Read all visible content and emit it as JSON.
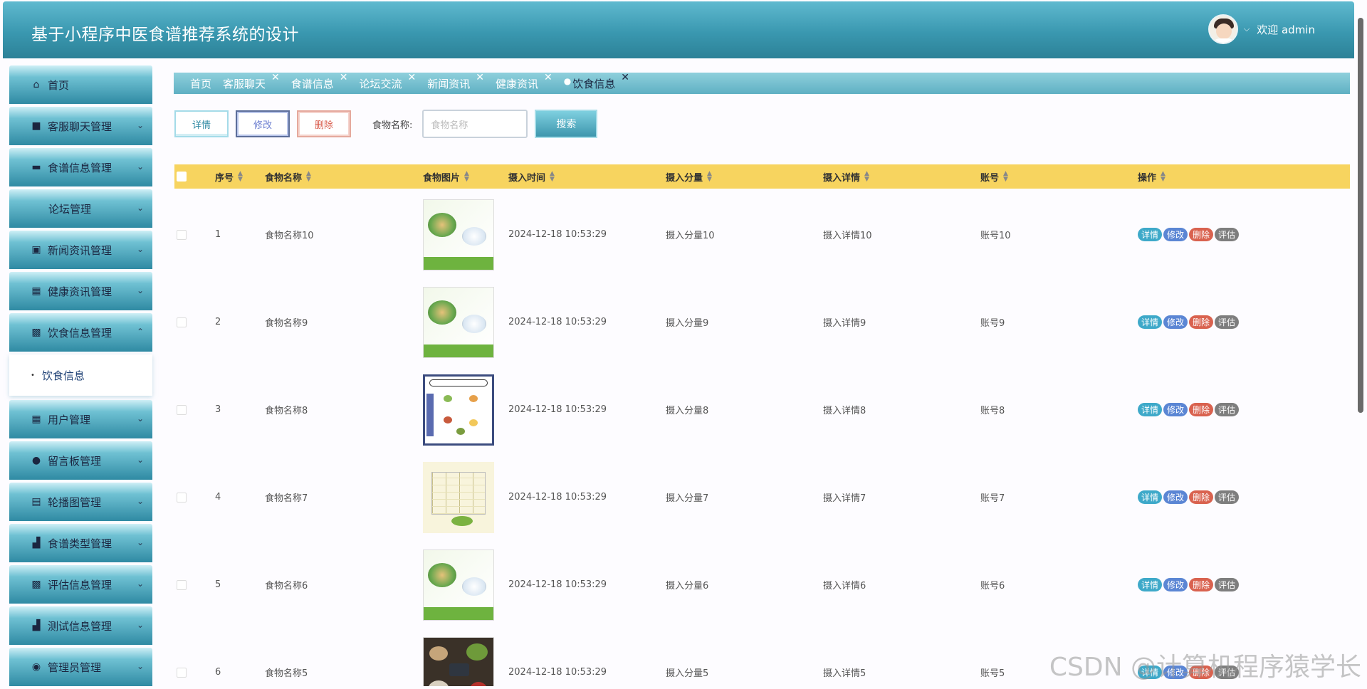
{
  "header": {
    "title": "基于小程序中医食谱推荐系统的设计",
    "welcome": "欢迎 admin"
  },
  "sidebar": {
    "items": [
      {
        "label": "首页",
        "icon": "home-icon"
      },
      {
        "label": "客服聊天管理",
        "icon": "mouse-icon"
      },
      {
        "label": "食谱信息管理",
        "icon": "card-icon"
      },
      {
        "label": "论坛管理",
        "icon": ""
      },
      {
        "label": "新闻资讯管理",
        "icon": "chip-icon"
      },
      {
        "label": "健康资讯管理",
        "icon": "grid-icon"
      },
      {
        "label": "饮食信息管理",
        "icon": "layout-icon"
      },
      {
        "label": "用户管理",
        "icon": "grid-icon"
      },
      {
        "label": "留言板管理",
        "icon": "drop-icon"
      },
      {
        "label": "轮播图管理",
        "icon": "list-icon"
      },
      {
        "label": "食谱类型管理",
        "icon": "chart-icon"
      },
      {
        "label": "评估信息管理",
        "icon": "layout-icon"
      },
      {
        "label": "测试信息管理",
        "icon": "chart-icon"
      },
      {
        "label": "管理员管理",
        "icon": "user-icon"
      }
    ],
    "submenu": "饮食信息"
  },
  "tabs": [
    "首页",
    "客服聊天",
    "食谱信息",
    "论坛交流",
    "新闻资讯",
    "健康资讯",
    "饮食信息"
  ],
  "toolbar": {
    "detail": "详情",
    "edit": "修改",
    "delete": "删除",
    "search_label": "食物名称:",
    "search_placeholder": "食物名称",
    "search_button": "搜索"
  },
  "table": {
    "headers": [
      "序号",
      "食物名称",
      "食物图片",
      "摄入时间",
      "摄入分量",
      "摄入详情",
      "账号",
      "操作"
    ],
    "rows": [
      {
        "no": "1",
        "name": "食物名称10",
        "time": "2024-12-18 10:53:29",
        "amount": "摄入分量10",
        "detail": "摄入详情10",
        "account": "账号10"
      },
      {
        "no": "2",
        "name": "食物名称9",
        "time": "2024-12-18 10:53:29",
        "amount": "摄入分量9",
        "detail": "摄入详情9",
        "account": "账号9"
      },
      {
        "no": "3",
        "name": "食物名称8",
        "time": "2024-12-18 10:53:29",
        "amount": "摄入分量8",
        "detail": "摄入详情8",
        "account": "账号8"
      },
      {
        "no": "4",
        "name": "食物名称7",
        "time": "2024-12-18 10:53:29",
        "amount": "摄入分量7",
        "detail": "摄入详情7",
        "account": "账号7"
      },
      {
        "no": "5",
        "name": "食物名称6",
        "time": "2024-12-18 10:53:29",
        "amount": "摄入分量6",
        "detail": "摄入详情6",
        "account": "账号6"
      },
      {
        "no": "6",
        "name": "食物名称5",
        "time": "2024-12-18 10:53:29",
        "amount": "摄入分量5",
        "detail": "摄入详情5",
        "account": "账号5"
      }
    ],
    "ops": [
      "详情",
      "修改",
      "删除",
      "评估"
    ]
  },
  "watermark": "CSDN @计算机程序猿学长"
}
